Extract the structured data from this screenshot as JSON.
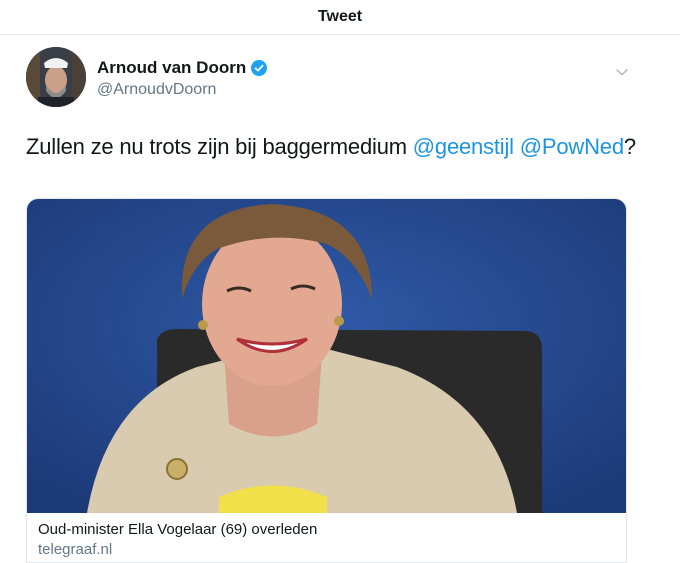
{
  "header": {
    "title": "Tweet"
  },
  "tweet": {
    "author": {
      "display_name": "Arnoud van Doorn",
      "handle": "@ArnoudvDoorn",
      "verified": true,
      "avatar_icon": "avatar-photo"
    },
    "text": {
      "prefix": "Zullen ze nu trots zijn bij baggermedium ",
      "mention1": "@geenstijl",
      "space": " ",
      "mention2": "@PowNed",
      "suffix": "?"
    },
    "card": {
      "image_icon": "news-photo",
      "title": "Oud-minister Ella Vogelaar (69) overleden",
      "domain": "telegraaf.nl"
    }
  },
  "colors": {
    "link": "#1b95e0",
    "secondary_text": "#657786",
    "border": "#e1e8ed",
    "verified_badge": "#1da1f2"
  }
}
